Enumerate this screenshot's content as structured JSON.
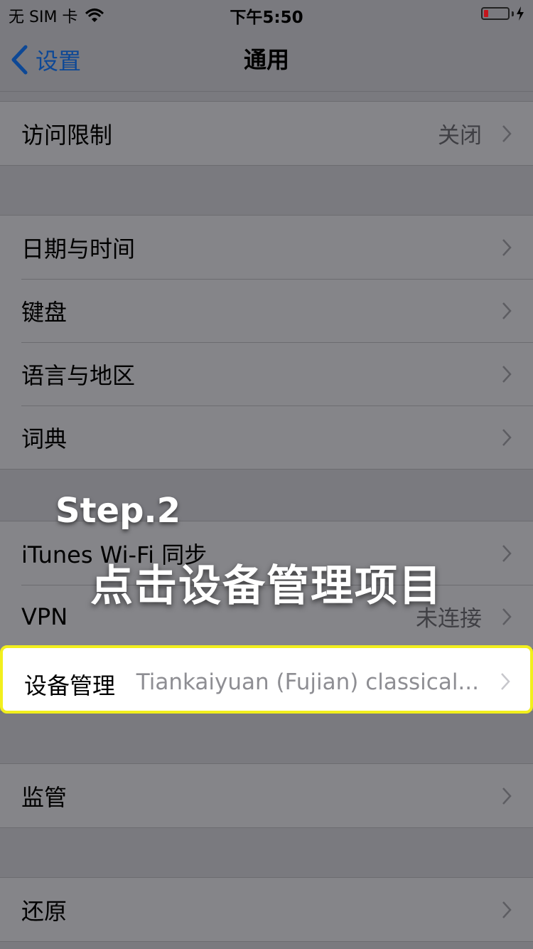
{
  "status_bar": {
    "carrier": "无 SIM 卡",
    "time": "下午5:50"
  },
  "nav": {
    "back_label": "设置",
    "title": "通用"
  },
  "sections": [
    {
      "rows": [
        {
          "label": "访问限制",
          "value": "关闭"
        }
      ]
    },
    {
      "rows": [
        {
          "label": "日期与时间",
          "value": ""
        },
        {
          "label": "键盘",
          "value": ""
        },
        {
          "label": "语言与地区",
          "value": ""
        },
        {
          "label": "词典",
          "value": ""
        }
      ]
    },
    {
      "rows": [
        {
          "label": "iTunes Wi-Fi 同步",
          "value": ""
        },
        {
          "label": "VPN",
          "value": "未连接"
        },
        {
          "label": "设备管理",
          "value": "Tiankaiyuan (Fujian) classical..."
        }
      ]
    },
    {
      "rows": [
        {
          "label": "监管",
          "value": ""
        }
      ]
    },
    {
      "rows": [
        {
          "label": "还原",
          "value": ""
        }
      ]
    }
  ],
  "overlay": {
    "step": "Step.2",
    "instruction": "点击设备管理项目"
  },
  "colors": {
    "background": "#7a7a7f",
    "cell": "#858589",
    "highlight_border": "#f2ef1d",
    "link": "#0d4896",
    "battery_low": "#c4151c"
  }
}
